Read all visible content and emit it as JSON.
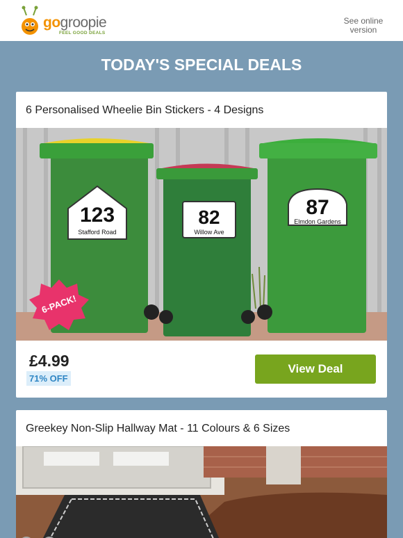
{
  "header": {
    "logo_go": "go",
    "logo_groopie": "groopie",
    "logo_tagline": "FEEL GOOD DEALS",
    "see_online": "See online version"
  },
  "hero": {
    "title": "TODAY'S SPECIAL DEALS"
  },
  "deals": [
    {
      "title": "6 Personalised Wheelie Bin Stickers - 4 Designs",
      "price": "£4.99",
      "discount": "71% OFF",
      "cta": "View Deal",
      "image": {
        "badge": "6-PACK!",
        "bins": [
          {
            "number": "123",
            "street": "Stafford Road",
            "lid_color": "#e8d22a"
          },
          {
            "number": "82",
            "street": "Willow Ave",
            "lid_color": "#c43a55"
          },
          {
            "number": "87",
            "street": "Elmdon Gardens",
            "lid_color": "#3cae3c"
          }
        ]
      }
    },
    {
      "title": "Greekey Non-Slip Hallway Mat - 11 Colours & 6 Sizes"
    }
  ],
  "colors": {
    "background": "#7a9bb4",
    "cta_green": "#78a51e",
    "discount_bg": "#dceefa",
    "discount_text": "#2f86c4",
    "brand_orange": "#f39200"
  }
}
